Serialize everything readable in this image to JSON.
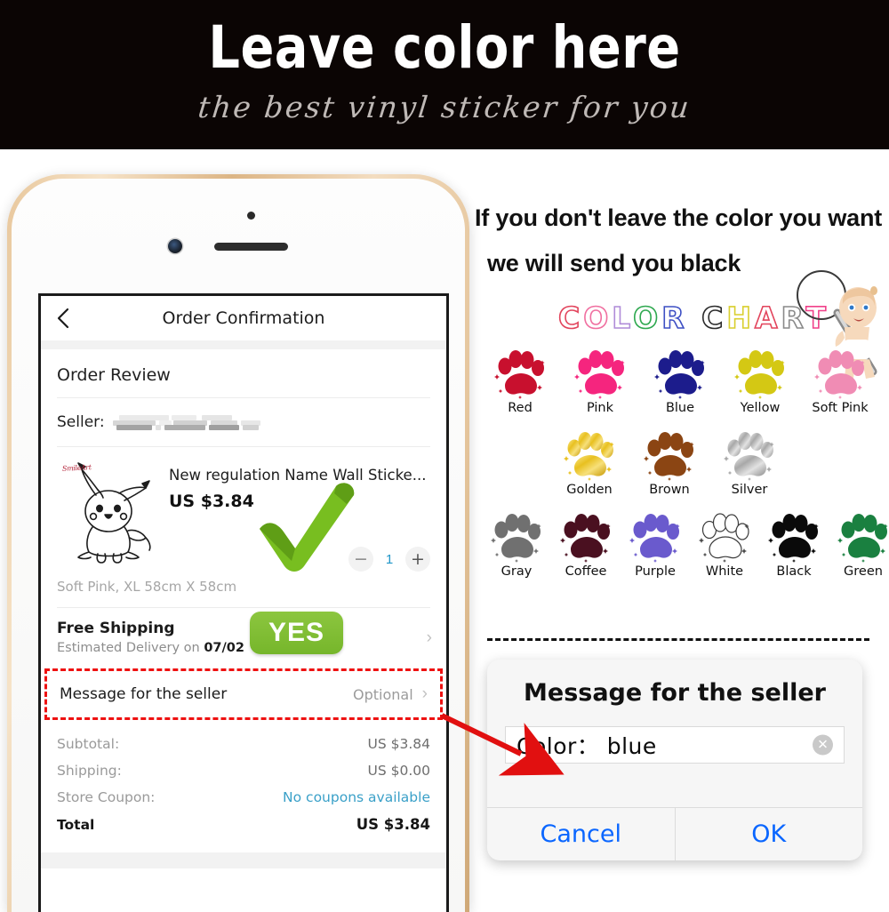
{
  "banner": {
    "title": "Leave color here",
    "subtitle": "the best vinyl sticker for you",
    "bg_color": "#0b0504"
  },
  "notice": {
    "line1": "If you don't leave the color you want",
    "line2": "we will send you black"
  },
  "phone_screen": {
    "nav": {
      "back_icon": "chevron-left-icon",
      "title": "Order Confirmation"
    },
    "section_title": "Order Review",
    "seller": {
      "label": "Seller:",
      "value_hidden": true
    },
    "product": {
      "watermark": "SmileArt",
      "name": "New regulation Name Wall Sticke...",
      "price": "US $3.84",
      "variant": "Soft Pink, XL 58cm X 58cm",
      "quantity": "1",
      "minus_label": "−",
      "plus_label": "+"
    },
    "shipping": {
      "title": "Free Shipping",
      "estimate_prefix": "Estimated Delivery on",
      "estimate_date": "07/02",
      "badge": "YES",
      "chevron": "›"
    },
    "message_row": {
      "label": "Message for the seller",
      "value": "Optional",
      "chevron": "›"
    },
    "totals": [
      {
        "key": "Subtotal:",
        "value": "US $3.84",
        "link": false
      },
      {
        "key": "Shipping:",
        "value": "US $0.00",
        "link": false
      },
      {
        "key": "Store Coupon:",
        "value": "No coupons available",
        "link": true
      }
    ],
    "grand_total": {
      "key": "Total",
      "value": "US $3.84"
    }
  },
  "color_chart": {
    "title_letters": [
      {
        "ch": "C",
        "color": "#e2445c"
      },
      {
        "ch": "O",
        "color": "#f06fa0"
      },
      {
        "ch": "L",
        "color": "#b08cd8"
      },
      {
        "ch": "O",
        "color": "#2ea84f"
      },
      {
        "ch": "R",
        "color": "#3d4fc4"
      },
      {
        "ch": " ",
        "color": "#ffffff"
      },
      {
        "ch": "C",
        "color": "#2b2b2b"
      },
      {
        "ch": "H",
        "color": "#d9cf2f"
      },
      {
        "ch": "A",
        "color": "#e2445c"
      },
      {
        "ch": "R",
        "color": "#8a8a8a"
      },
      {
        "ch": "T",
        "color": "#f0418a"
      }
    ],
    "rows": [
      [
        {
          "label": "Red",
          "color": "#c8102e",
          "type": "solid"
        },
        {
          "label": "Pink",
          "color": "#f5257e",
          "type": "solid"
        },
        {
          "label": "Blue",
          "color": "#1c1c8c",
          "type": "solid"
        },
        {
          "label": "Yellow",
          "color": "#d4c814",
          "type": "solid"
        },
        {
          "label": "Soft Pink",
          "color": "#f08cb4",
          "type": "solid"
        }
      ],
      [
        {
          "label": "Golden",
          "color": "#e8c020",
          "type": "metallic"
        },
        {
          "label": "Brown",
          "color": "#8b4513",
          "type": "solid"
        },
        {
          "label": "Silver",
          "color": "#b4b4b4",
          "type": "metallic"
        }
      ],
      [
        {
          "label": "Gray",
          "color": "#707070",
          "type": "solid"
        },
        {
          "label": "Coffee",
          "color": "#4a1020",
          "type": "solid"
        },
        {
          "label": "Purple",
          "color": "#6a5acd",
          "type": "solid"
        },
        {
          "label": "White",
          "color": "#ffffff",
          "type": "outline"
        },
        {
          "label": "Black",
          "color": "#0a0a0a",
          "type": "solid"
        },
        {
          "label": "Green",
          "color": "#1a8040",
          "type": "solid"
        }
      ]
    ]
  },
  "dialog": {
    "title": "Message for the seller",
    "input_value": "Color： blue",
    "clear_icon": "clear-circle-icon",
    "cancel_label": "Cancel",
    "ok_label": "OK"
  }
}
